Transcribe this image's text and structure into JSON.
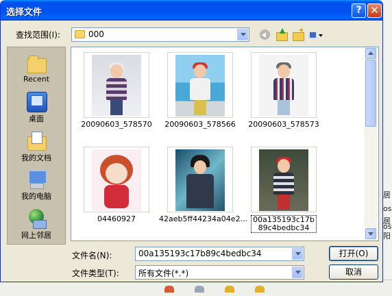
{
  "dialog": {
    "title": "选择文件",
    "help_label": "?",
    "close_label": "✕"
  },
  "lookin": {
    "label": "查找范围(I):",
    "value": "000"
  },
  "places": [
    {
      "label": "Recent",
      "icon": "recent-folder-icon"
    },
    {
      "label": "桌面",
      "icon": "desktop-icon"
    },
    {
      "label": "我的文档",
      "icon": "my-documents-icon"
    },
    {
      "label": "我的电脑",
      "icon": "my-computer-icon"
    },
    {
      "label": "网上邻居",
      "icon": "network-places-icon"
    }
  ],
  "files": [
    {
      "name": "20090603_578570",
      "selected": false
    },
    {
      "name": "20090603_578566",
      "selected": false
    },
    {
      "name": "20090603_578573",
      "selected": false
    },
    {
      "name": "04460927",
      "selected": false
    },
    {
      "name": "42aeb5ff44234a04e2...",
      "selected": false
    },
    {
      "name": "00a135193c17b89c4bedbc34",
      "selected": true
    }
  ],
  "filename": {
    "label": "文件名(N):",
    "value": "00a135193c17b89c4bedbc34"
  },
  "filetype": {
    "label": "文件类型(T):",
    "value": "所有文件(*.*)"
  },
  "buttons": {
    "open": "打开(O)",
    "cancel": "取消"
  },
  "background_fragments": [
    "居",
    "os",
    "居",
    "os",
    "阳"
  ],
  "colors": {
    "titlebar": "#0053ee",
    "dialog_bg": "#ece9d8",
    "places_bg": "#c7c1ad",
    "border": "#7f9db9"
  }
}
